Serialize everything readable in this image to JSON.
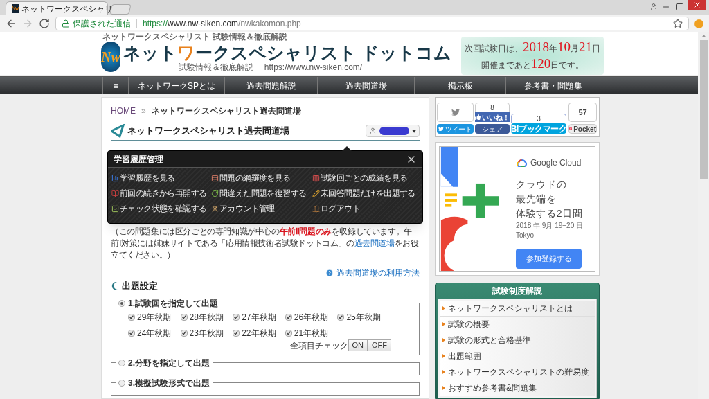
{
  "browser": {
    "tab": {
      "favicon": "Nw",
      "title": "ネットワークスペシャリ"
    },
    "address": {
      "secure_label": "保護された通信",
      "url": [
        {
          "text": "https://",
          "kind": "scheme"
        },
        {
          "text": "www.nw-siken.com",
          "kind": "host"
        },
        {
          "text": "/nwkakomon.php",
          "kind": "path"
        }
      ]
    }
  },
  "header": {
    "tagline": "ネットワークスペシャリスト 試験情報＆徹底解説",
    "logo_text": "Nw",
    "site_name": [
      {
        "text": "ネット",
        "kind": "plain"
      },
      {
        "text": "ワ",
        "kind": "accent"
      },
      {
        "text": "ークスペシャリスト ドットコム",
        "kind": "plain"
      }
    ],
    "subtitle": "試験情報＆徹底解説",
    "site_url": "https://www.nw-siken.com/",
    "countdown": [
      [
        {
          "text": "次回試験日は、",
          "kind": "plain"
        },
        {
          "text": "2018",
          "kind": "number"
        },
        {
          "text": "年",
          "kind": "plain"
        },
        {
          "text": "10",
          "kind": "number"
        },
        {
          "text": "月",
          "kind": "plain"
        },
        {
          "text": "21",
          "kind": "number"
        },
        {
          "text": "日",
          "kind": "plain"
        }
      ],
      [
        {
          "text": "開催まであと",
          "kind": "plain"
        },
        {
          "text": "120",
          "kind": "number"
        },
        {
          "text": "日です。",
          "kind": "plain"
        }
      ]
    ]
  },
  "nav": [
    "≡",
    "ネットワークSPとは",
    "過去問題解説",
    "過去問道場",
    "掲示板",
    "参考書・問題集"
  ],
  "breadcrumb": {
    "home": "HOME",
    "separator": "»",
    "current": "ネットワークスペシャリスト過去問道場"
  },
  "page_title": "ネットワークスペシャリスト過去問道場",
  "popup": {
    "title": "学習履歴管理",
    "items": [
      "学習履歴を見る",
      "問題の網羅度を見る",
      "試験回ごとの成績を見る",
      "前回の続きから再開する",
      "間違えた問題を復習する",
      "未回答問題だけを出題する",
      "チェック状態を確認する",
      "アカウント管理",
      "ログアウト"
    ]
  },
  "notice": [
    {
      "text": "（この問題集には区分ごとの専門知識が中心の",
      "kind": "plain"
    },
    {
      "text": "午前Ⅱ問題のみ",
      "kind": "emphasis"
    },
    {
      "text": "を収録しています。午前Ⅰ対策には姉妹サイトである「応用情報技術者試験ドットコム」の",
      "kind": "plain"
    },
    {
      "text": "過去問道場",
      "kind": "link"
    },
    {
      "text": "をお役立てください。）",
      "kind": "plain"
    }
  ],
  "usage_link": "過去問道場の利用方法",
  "section_title": "出題設定",
  "modes": [
    {
      "label": "1.試験回を指定して出題",
      "selected": true,
      "sessions": [
        {
          "label": "29年秋期",
          "checked": true
        },
        {
          "label": "28年秋期",
          "checked": true
        },
        {
          "label": "27年秋期",
          "checked": true
        },
        {
          "label": "26年秋期",
          "checked": true
        },
        {
          "label": "25年秋期",
          "checked": true
        },
        {
          "label": "24年秋期",
          "checked": true
        },
        {
          "label": "23年秋期",
          "checked": true
        },
        {
          "label": "22年秋期",
          "checked": true
        },
        {
          "label": "21年秋期",
          "checked": true
        }
      ],
      "check_all": {
        "label": "全項目チェック",
        "buttons": [
          "ON",
          "OFF"
        ]
      }
    },
    {
      "label": "2.分野を指定して出題",
      "selected": false
    },
    {
      "label": "3.模擬試験形式で出題",
      "selected": false
    }
  ],
  "share": [
    {
      "kind": "twitter",
      "label": "ツイート"
    },
    {
      "kind": "facebook",
      "count": "8",
      "like": "いいね！",
      "label": "シェア"
    },
    {
      "kind": "hatena",
      "count": "3",
      "mark": "B!",
      "label": "ブックマーク"
    },
    {
      "kind": "pocket",
      "count": "57",
      "label": "Pocket"
    }
  ],
  "ad": {
    "brand": "Google Cloud",
    "headline": [
      "クラウドの",
      "最先端を",
      "体験する2日間"
    ],
    "date": "2018 年 9月 19−20 日",
    "place": "Tokyo",
    "cta": "参加登録する"
  },
  "side_menu": {
    "title": "試験制度解説",
    "items": [
      "ネットワークスペシャリストとは",
      "試験の概要",
      "試験の形式と合格基準",
      "出題範囲",
      "ネットワークスペシャリストの難易度",
      "おすすめ参考書&問題集"
    ]
  }
}
